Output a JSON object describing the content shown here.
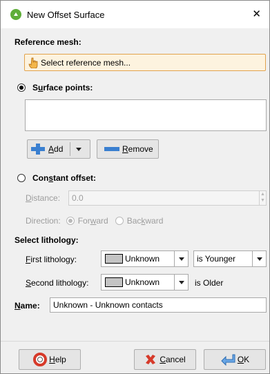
{
  "window": {
    "title": "New Offset Surface",
    "close_glyph": "✕",
    "app_icon": "leapfrog-app-icon"
  },
  "reference_mesh": {
    "label": "Reference mesh:",
    "button_label": "Select reference mesh...",
    "icon": "hand-pointer-icon"
  },
  "surface_points": {
    "label_prefix": "S",
    "label_u": "u",
    "label_suffix": "rface points:",
    "selected": true,
    "add": {
      "u": "A",
      "rest": "dd",
      "icon": "plus-icon"
    },
    "remove": {
      "u": "R",
      "rest": "emove",
      "icon": "minus-icon"
    }
  },
  "constant_offset": {
    "label_prefix": "Con",
    "label_u": "s",
    "label_suffix": "tant offset:",
    "selected": false,
    "distance_u": "D",
    "distance_rest": "istance:",
    "distance_value": "0.0",
    "direction_label": "Direction:",
    "forward_prefix": "For",
    "forward_u": "w",
    "forward_suffix": "ard",
    "forward_selected": true,
    "backward_prefix": "Bac",
    "backward_u": "k",
    "backward_suffix": "ward",
    "backward_selected": false
  },
  "lithology": {
    "section_label": "Select lithology:",
    "first_u": "F",
    "first_rest": "irst lithology:",
    "first_value": "Unknown",
    "relation_value": "is Younger",
    "second_u": "S",
    "second_rest": "econd lithology:",
    "second_value": "Unknown",
    "second_relation": "is Older",
    "swatch_color": "#c4c4c4"
  },
  "name": {
    "u": "N",
    "rest": "ame:",
    "value": "Unknown - Unknown contacts"
  },
  "footer": {
    "help_u": "H",
    "help_rest": "elp",
    "cancel_u": "C",
    "cancel_rest": "ancel",
    "ok_u": "O",
    "ok_rest": "K"
  },
  "colors": {
    "accent_orange": "#e2a24b",
    "button_highlight": "#fdf3df",
    "plus_blue": "#3a7fd0",
    "cancel_red": "#d63a2a"
  }
}
